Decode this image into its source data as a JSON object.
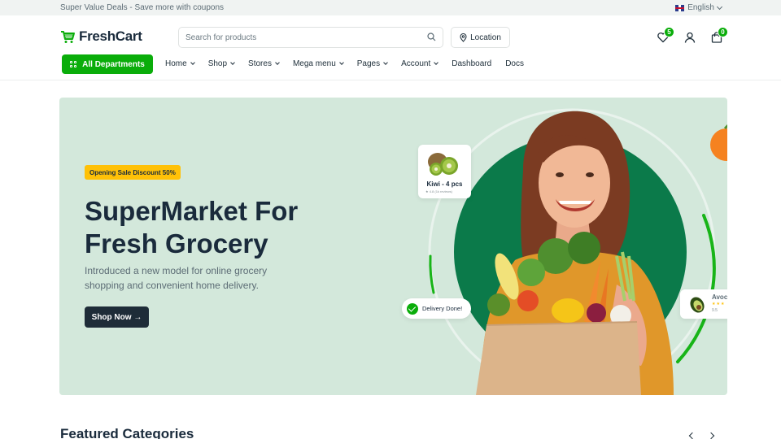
{
  "topbar": {
    "deal_text": "Super Value Deals - Save more with coupons",
    "language": "English"
  },
  "header": {
    "logo_text": "FreshCart",
    "search_placeholder": "Search for products",
    "location_label": "Location",
    "wishlist_count": "5",
    "cart_count": "0"
  },
  "nav": {
    "all_departments": "All Departments",
    "items": [
      {
        "label": "Home",
        "dropdown": true
      },
      {
        "label": "Shop",
        "dropdown": true
      },
      {
        "label": "Stores",
        "dropdown": true
      },
      {
        "label": "Mega menu",
        "dropdown": true
      },
      {
        "label": "Pages",
        "dropdown": true
      },
      {
        "label": "Account",
        "dropdown": true
      },
      {
        "label": "Dashboard",
        "dropdown": false
      },
      {
        "label": "Docs",
        "dropdown": false
      }
    ]
  },
  "hero": {
    "badge": "Opening Sale Discount 50%",
    "title_line1": "SuperMarket For",
    "title_line2": "Fresh Grocery",
    "description": "Introduced a new model for online grocery shopping and convenient home delivery.",
    "cta": "Shop Now →",
    "card_kiwi_name": "Kiwi - 4 pcs",
    "card_kiwi_meta": "★ 4.8  (1k reviews)",
    "card_delivery": "Delivery Done!",
    "card_avocado_name": "Avoc",
    "card_avocado_price": "9.5"
  },
  "featured": {
    "title": "Featured Categories"
  },
  "colors": {
    "brand_green": "#0aad0a",
    "hero_bg": "#d3e8db",
    "dark": "#1e2c38",
    "promo_yellow": "#ffc107"
  }
}
